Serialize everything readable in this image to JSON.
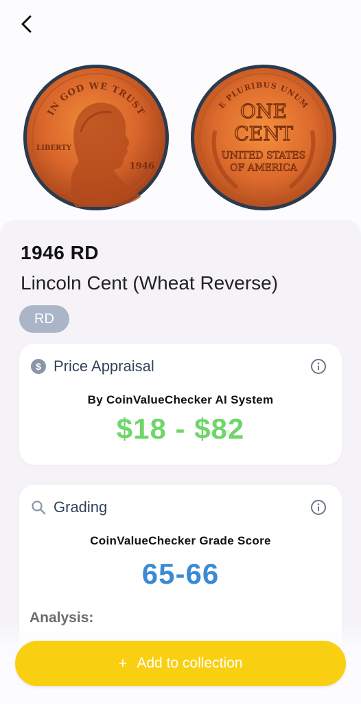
{
  "nav": {
    "back_icon": "chevron-left-icon"
  },
  "coin": {
    "year_mint": "1946 RD",
    "name": "Lincoln Cent (Wheat Reverse)",
    "designation": "RD",
    "obverse": {
      "legend_top": "IN GOD WE TRUST",
      "liberty": "LIBERTY",
      "date": "1946"
    },
    "reverse": {
      "legend_top": "E PLURIBUS UNUM",
      "denomination_line1": "ONE",
      "denomination_line2": "CENT",
      "country_line1": "UNITED STATES",
      "country_line2": "OF AMERICA"
    }
  },
  "price_card": {
    "title": "Price Appraisal",
    "icon": "dollar-coin-icon",
    "subtitle": "By CoinValueChecker AI System",
    "range": "$18 - $82",
    "range_color": "#6fd66a"
  },
  "grading_card": {
    "title": "Grading",
    "icon": "search-icon",
    "subtitle": "CoinValueChecker Grade Score",
    "score": "65-66",
    "score_color": "#3a8ad4",
    "analysis_label": "Analysis:"
  },
  "action": {
    "add_icon": "plus-icon",
    "add_label": "Add to collection",
    "button_color": "#f9cf12"
  }
}
